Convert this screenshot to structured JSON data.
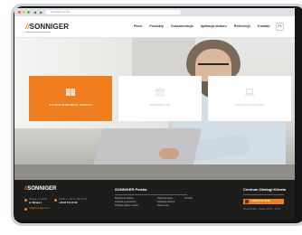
{
  "browser": {
    "url": "sonniger.com/pl"
  },
  "header": {
    "logo_prefix": "//",
    "logo_text": "SONNIGER",
    "menu": [
      "Piece",
      "Produkty",
      "Dokumentacja",
      "Aplikacja doboru",
      "Referencje",
      "Kontakt"
    ],
    "lang": "PL"
  },
  "cards": [
    {
      "label": "KALKULATOR MOCY CIEPŁEJ",
      "active": true,
      "icon": "book-icon"
    },
    {
      "label": "REFERENCJE",
      "active": false,
      "icon": "building-icon"
    },
    {
      "label": "APLIKACJA DOBORU",
      "active": false,
      "icon": "laptop-icon"
    }
  ],
  "footer": {
    "logo_prefix": "//",
    "logo_text": "SONNIGER",
    "address_label": "Wyspa 1, Kraków",
    "address_value": "ul. Wyspa 1",
    "phone_label": "Telefon / +48 34 741 10 49",
    "phone_value": "+48 34 741 10 49",
    "email": "info@sonniger.com",
    "company_title": "SONNIGER Polska",
    "col1": [
      "Regulamin sklepu",
      "Polityka prywatności",
      "Polityka plików cookies"
    ],
    "col2": [
      "Dokumentacja",
      "Aplikacja doboru",
      "Referencje"
    ],
    "col3": [
      "Kontakt"
    ],
    "support_title": "Centrum Obsługi Klienta",
    "support_button": "+48 34 741 10 49",
    "hours": "Poniedziałek - Piątek: 08:00 - 16:00"
  },
  "colors": {
    "accent": "#f07d1e",
    "footer_bg": "#1d1d1b"
  }
}
